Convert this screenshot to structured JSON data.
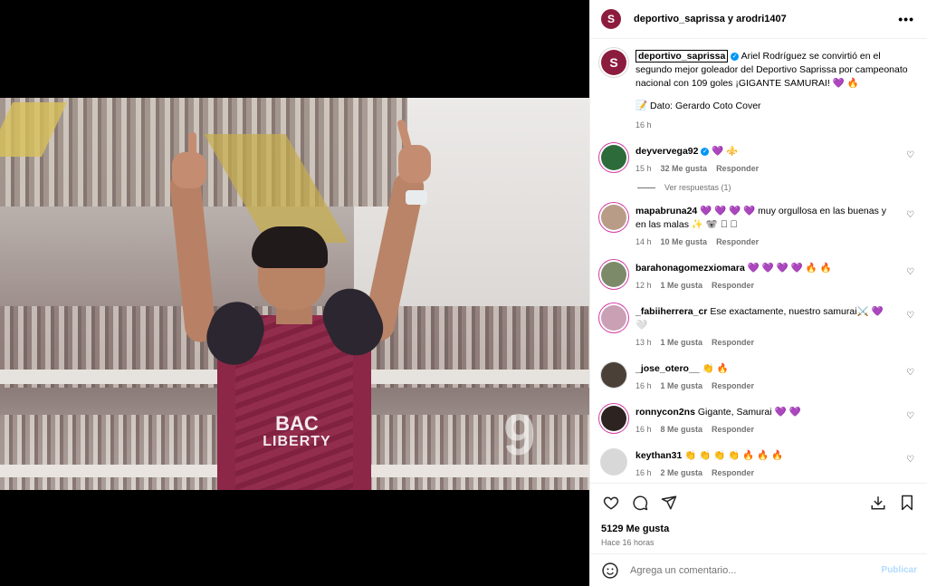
{
  "header": {
    "avatar_letter": "S",
    "title": "deportivo_saprissa y arodri1407",
    "more": "•••"
  },
  "caption": {
    "avatar_letter": "S",
    "username": "deportivo_saprissa",
    "verified_glyph": "✓",
    "text": "Ariel Rodríguez se convirtió en el segundo mejor goleador del Deportivo Saprissa por campeonato nacional con 109 goles ¡GIGANTE SAMURAI! 💜 🔥",
    "source": "📝 Dato: Gerardo Coto Cover",
    "time": "16 h"
  },
  "comments": [
    {
      "username": "deyvervega92",
      "verified": true,
      "text": "💜 ⚜️",
      "time": "15 h",
      "likes": "32 Me gusta",
      "reply": "Responder",
      "avatar_color": "#2e6b3a",
      "ring": true,
      "view_replies": "Ver respuestas (1)"
    },
    {
      "username": "mapabruna24",
      "verified": false,
      "text": "💜 💜 💜 💜  muy orgullosa en las buenas y en las malas ✨ 🐨 🏻 🏻",
      "time": "14 h",
      "likes": "10 Me gusta",
      "reply": "Responder",
      "avatar_color": "#b89c88",
      "ring": true
    },
    {
      "username": "barahonagomezxiomara",
      "verified": false,
      "text": "💜 💜 💜 💜 🔥 🔥",
      "time": "12 h",
      "likes": "1 Me gusta",
      "reply": "Responder",
      "avatar_color": "#7c8a6a",
      "ring": true
    },
    {
      "username": "_fabiiherrera_cr",
      "verified": false,
      "text": "Ese exactamente, nuestro samurai⚔️ 💜 🤍",
      "time": "13 h",
      "likes": "1 Me gusta",
      "reply": "Responder",
      "avatar_color": "#c9a0b4",
      "ring": true
    },
    {
      "username": "_jose_otero__",
      "verified": false,
      "text": "👏 🔥",
      "time": "16 h",
      "likes": "1 Me gusta",
      "reply": "Responder",
      "avatar_color": "#4a4038",
      "ring": false
    },
    {
      "username": "ronnycon2ns",
      "verified": false,
      "text": "Gigante, Samurai 💜 💜",
      "time": "16 h",
      "likes": "8 Me gusta",
      "reply": "Responder",
      "avatar_color": "#2d2320",
      "ring": true
    },
    {
      "username": "keythan31",
      "verified": false,
      "text": "👏 👏 👏 👏 🔥 🔥 🔥",
      "time": "16 h",
      "likes": "2 Me gusta",
      "reply": "Responder",
      "avatar_color": "#d8d8d8",
      "ring": false
    }
  ],
  "media": {
    "sponsor_line1": "BAC",
    "sponsor_line2": "LIBERTY",
    "jersey_number": "9"
  },
  "actions": {
    "likes": "5129 Me gusta",
    "posted": "Hace 16 horas"
  },
  "composer": {
    "placeholder": "Agrega un comentario...",
    "post": "Publicar"
  },
  "colors": {
    "brand": "#8c1c3d",
    "link": "#0095f6",
    "muted": "#737373"
  }
}
